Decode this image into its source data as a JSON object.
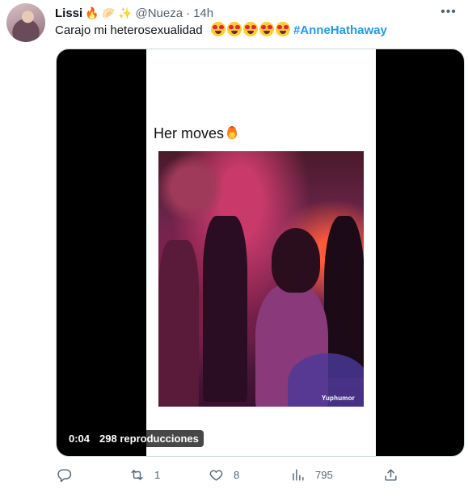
{
  "tweet": {
    "author": {
      "display_name": "Lissi",
      "emojis": [
        "🔥",
        "🥟",
        "✨"
      ],
      "handle": "@Nueza",
      "separator": "·",
      "time": "14h"
    },
    "more_icon": "more-horizontal-icon",
    "text": {
      "body": "Carajo mi heterosexualidad",
      "emoji_count": 5,
      "hashtag": "#AnneHathaway"
    },
    "media": {
      "caption": "Her moves",
      "watermark": "Yuphumor",
      "time": "0:04",
      "views": "298 reproducciones"
    },
    "actions": {
      "reply": {
        "icon": "reply-icon",
        "count": ""
      },
      "retweet": {
        "icon": "retweet-icon",
        "count": "1"
      },
      "like": {
        "icon": "heart-icon",
        "count": "8"
      },
      "views": {
        "icon": "views-chart-icon",
        "count": "795"
      },
      "share": {
        "icon": "share-icon",
        "count": ""
      }
    },
    "colors": {
      "link": "#1d9bf0",
      "text": "#0f1419",
      "muted": "#536471"
    }
  }
}
